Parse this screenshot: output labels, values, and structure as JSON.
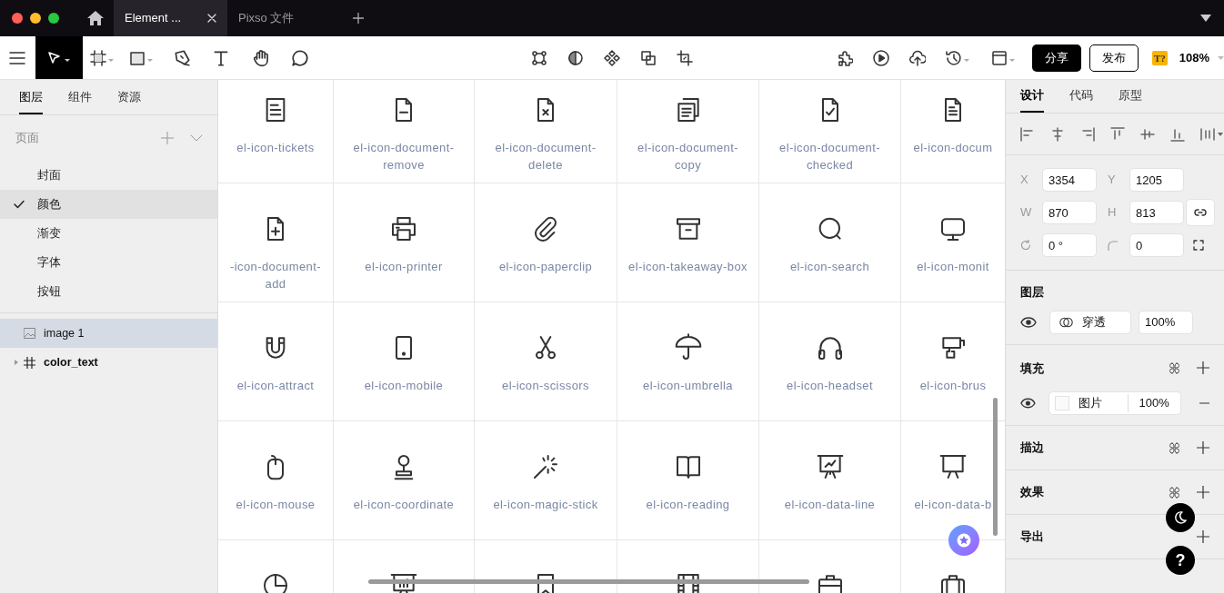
{
  "tabs": [
    {
      "label": "Element ...",
      "selected": true
    },
    {
      "label": "Pixso 文件",
      "selected": false
    }
  ],
  "tools": [
    {
      "selected": true
    },
    {
      "selected": false
    },
    {
      "selected": false
    },
    {
      "selected": false
    },
    {
      "selected": false
    },
    {
      "selected": false
    },
    {
      "selected": false
    }
  ],
  "share_button": "分享",
  "help_button": "?",
  "publish_button": "发布",
  "badge": "T?",
  "zoom": "108%",
  "left_panel": {
    "tabs": [
      {
        "label": "图层",
        "selected": true
      },
      {
        "label": "组件",
        "selected": false
      },
      {
        "label": "资源",
        "selected": false
      }
    ],
    "pages_header": "页面",
    "pages": [
      {
        "label": "封面",
        "selected": false
      },
      {
        "label": "颜色",
        "selected": true
      },
      {
        "label": "渐变",
        "selected": false
      },
      {
        "label": "字体",
        "selected": false
      },
      {
        "label": "按钮",
        "selected": false
      }
    ],
    "layers": [
      {
        "name": "image 1",
        "kind": "image",
        "selected": true
      },
      {
        "name": "color_text",
        "kind": "frame",
        "selected": false,
        "expanded": false
      }
    ]
  },
  "canvas": {
    "rows": [
      [
        "el-icon-tickets",
        "el-icon-document-remove",
        "el-icon-document-delete",
        "el-icon-document-copy",
        "el-icon-document-checked",
        "el-icon-docum"
      ],
      [
        "-icon-document-add",
        "el-icon-printer",
        "el-icon-paperclip",
        "el-icon-takeaway-box",
        "el-icon-search",
        "el-icon-monit"
      ],
      [
        "el-icon-attract",
        "el-icon-mobile",
        "el-icon-scissors",
        "el-icon-umbrella",
        "el-icon-headset",
        "el-icon-brus"
      ],
      [
        "el-icon-mouse",
        "el-icon-coordinate",
        "el-icon-magic-stick",
        "el-icon-reading",
        "el-icon-data-line",
        "el-icon-data-b"
      ]
    ]
  },
  "right_panel": {
    "tabs": [
      {
        "label": "设计",
        "selected": true
      },
      {
        "label": "代码",
        "selected": false
      },
      {
        "label": "原型",
        "selected": false
      }
    ],
    "fields": [
      {
        "kind": "text",
        "label": "X",
        "value": "3354"
      },
      {
        "kind": "text",
        "label": "Y",
        "value": "1205"
      },
      {
        "kind": "text",
        "label": "W",
        "value": "870"
      },
      {
        "kind": "text",
        "label": "H",
        "value": "813"
      },
      {
        "kind": "rotation",
        "value": "0 °"
      },
      {
        "kind": "radius",
        "value": "0"
      }
    ],
    "layer_title": "图层",
    "blend_mode": "穿透",
    "layer_opacity": "100%",
    "sections": [
      {
        "title": "填充",
        "kind": "fill",
        "fill_type": "图片",
        "fill_opacity": "100%"
      },
      {
        "title": "描边",
        "kind": "plain"
      },
      {
        "title": "效果",
        "kind": "plain"
      },
      {
        "title": "导出",
        "kind": "export"
      }
    ]
  }
}
